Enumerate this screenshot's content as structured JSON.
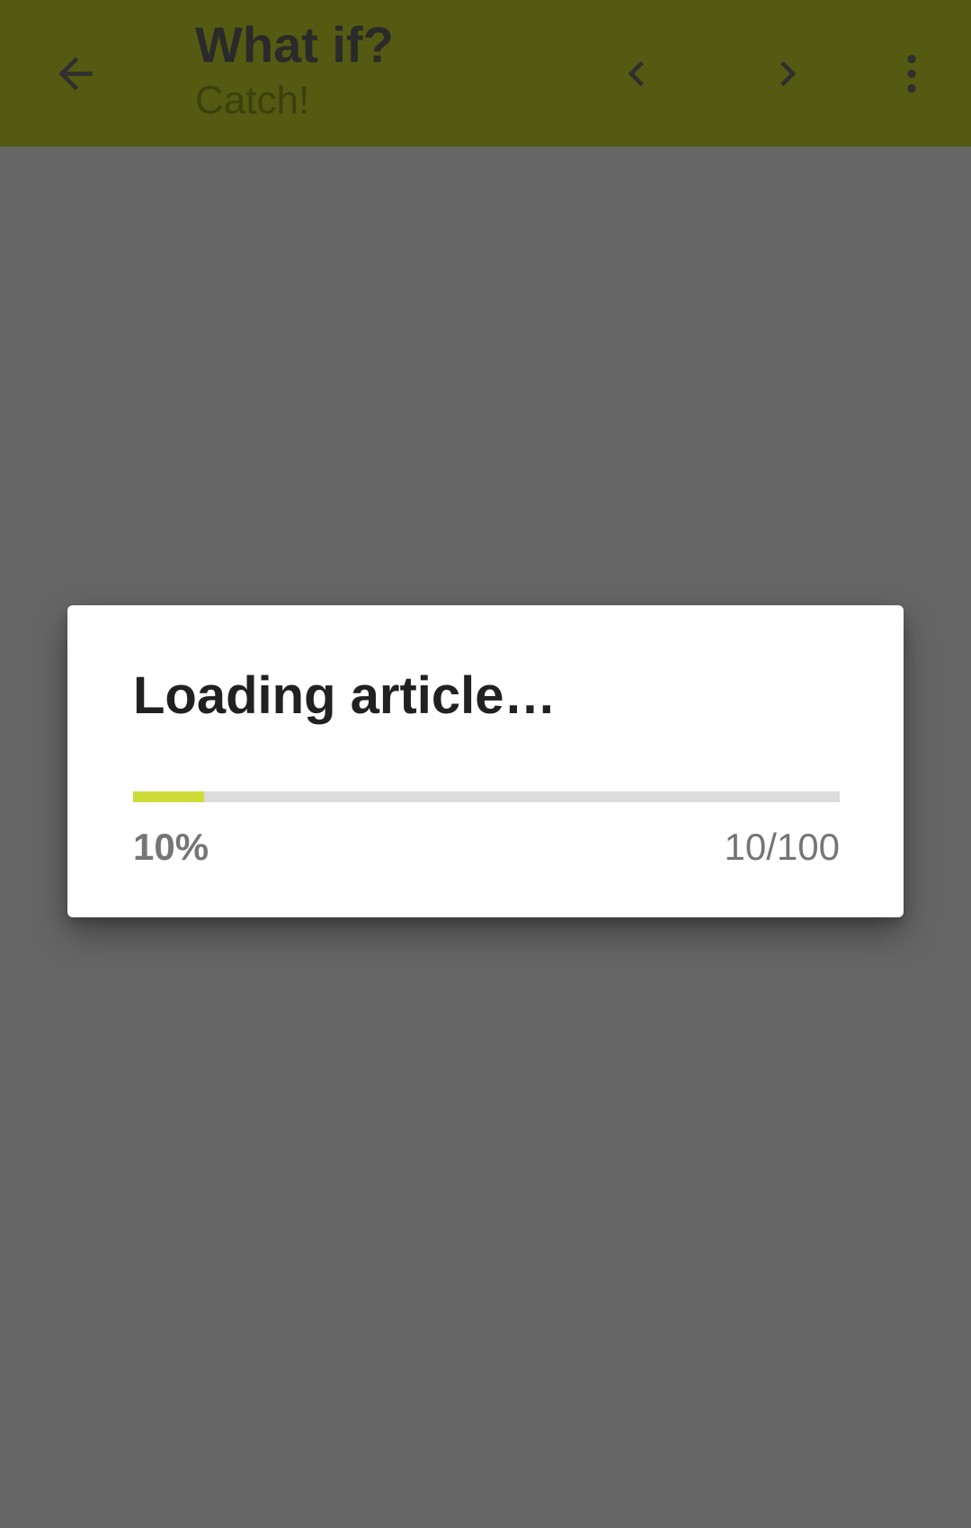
{
  "app_bar": {
    "title": "What if?",
    "subtitle": "Catch!",
    "icons": {
      "back": "arrow-back-icon",
      "previous": "chevron-left-icon",
      "next": "chevron-right-icon",
      "more": "more-vert-icon"
    },
    "color": "#a8b522"
  },
  "dialog": {
    "title": "Loading article…",
    "progress": {
      "fraction": 0.1,
      "percent_label": "10%",
      "count_label": "10/100"
    },
    "accent_color": "#cddc39"
  }
}
